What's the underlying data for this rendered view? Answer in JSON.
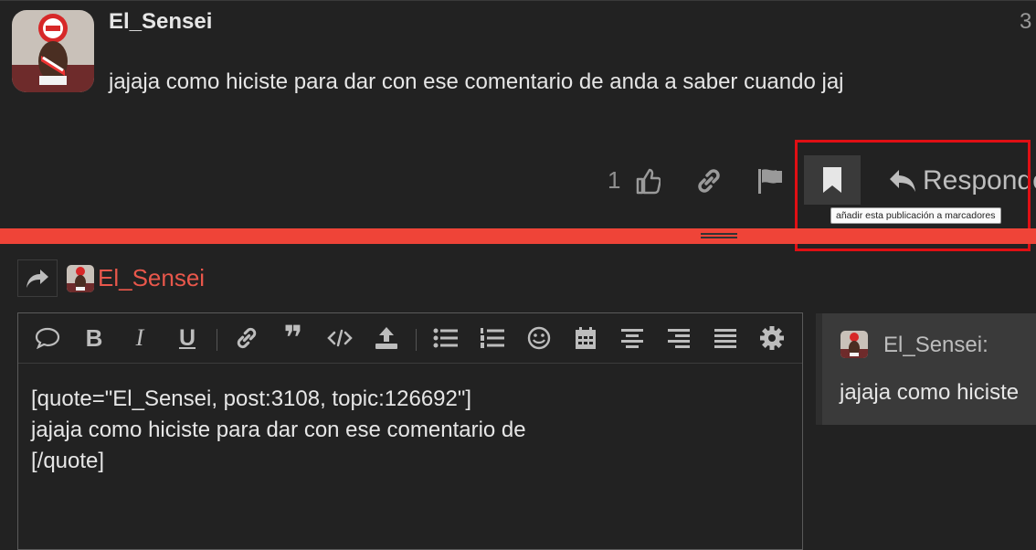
{
  "post": {
    "username": "El_Sensei",
    "date_fragment": "3",
    "body": "jajaja como hiciste para dar con ese comentario de anda a saber cuando jaj",
    "like_count": "1",
    "reply_label": "Responder",
    "bookmark_tooltip": "añadir esta publicación a marcadores"
  },
  "composer": {
    "reply_to_username": "El_Sensei",
    "editor_lines": [
      "[quote=\"El_Sensei, post:3108, topic:126692\"]",
      "jajaja como hiciste para dar con ese comentario de",
      "[/quote]"
    ],
    "toolbar_icons": [
      "speech-bubble-icon",
      "bold-icon",
      "italic-icon",
      "underline-icon",
      "link-icon",
      "quote-icon",
      "code-icon",
      "upload-icon",
      "bullet-list-icon",
      "numbered-list-icon",
      "emoji-icon",
      "calendar-icon",
      "align-center-icon",
      "align-right-icon",
      "justify-icon",
      "gear-icon"
    ],
    "bold_glyph": "B",
    "italic_glyph": "I",
    "underline_glyph": "U",
    "quote_glyph": "❞"
  },
  "preview": {
    "username": "El_Sensei:",
    "body": "jajaja como hiciste"
  },
  "colors": {
    "accent_red": "#ef4438",
    "highlight_red": "#e00f14",
    "background": "#222222"
  }
}
